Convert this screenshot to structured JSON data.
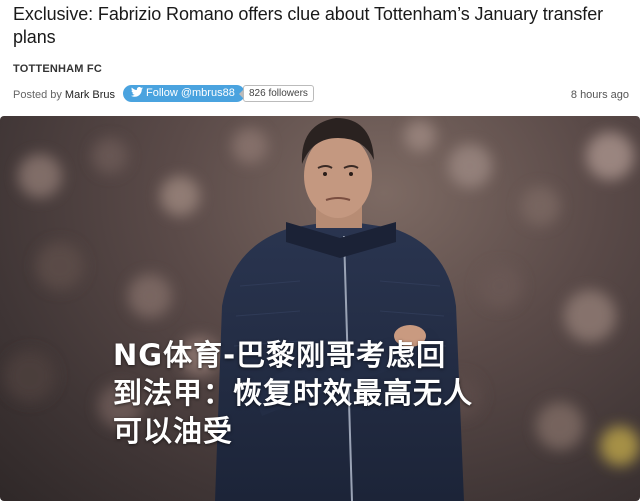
{
  "article": {
    "headline": "Exclusive: Fabrizio Romano offers clue about Tottenham’s January transfer plans",
    "category": "TOTTENHAM FC",
    "posted_by_label": "Posted by",
    "author": "Mark Brus",
    "follow_label": "Follow @mbrus88",
    "followers_count": "826 followers",
    "time_ago": "8 hours ago"
  },
  "photo": {
    "overlay_lines": [
      "NG体育-巴黎刚哥考虑回",
      "到法甲：恢复时效最高无人",
      "可以油受"
    ]
  },
  "icons": {
    "follow_icon": "twitter-bird-icon"
  },
  "colors": {
    "follow_button": "#4aa3df",
    "overlay_text": "#ffffff"
  }
}
